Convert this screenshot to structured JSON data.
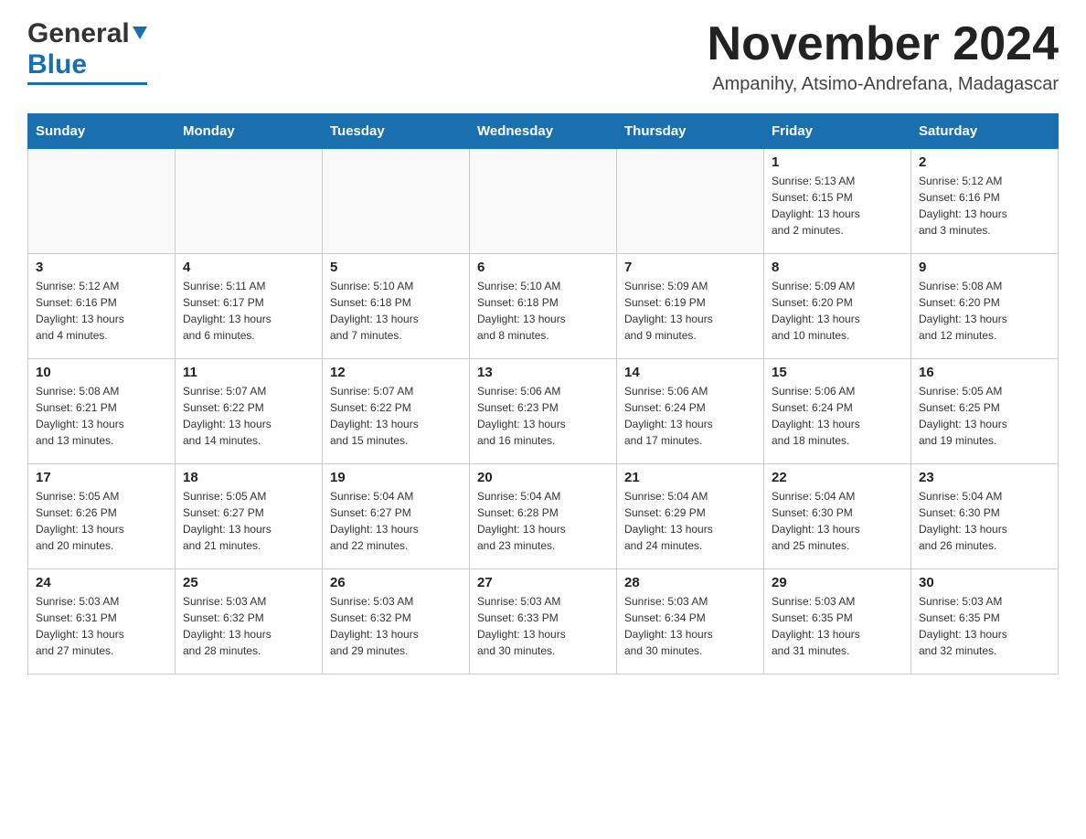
{
  "logo": {
    "general": "General",
    "blue": "Blue"
  },
  "header": {
    "month": "November 2024",
    "location": "Ampanihy, Atsimo-Andrefana, Madagascar"
  },
  "days_of_week": [
    "Sunday",
    "Monday",
    "Tuesday",
    "Wednesday",
    "Thursday",
    "Friday",
    "Saturday"
  ],
  "weeks": [
    [
      {
        "day": "",
        "info": ""
      },
      {
        "day": "",
        "info": ""
      },
      {
        "day": "",
        "info": ""
      },
      {
        "day": "",
        "info": ""
      },
      {
        "day": "",
        "info": ""
      },
      {
        "day": "1",
        "info": "Sunrise: 5:13 AM\nSunset: 6:15 PM\nDaylight: 13 hours\nand 2 minutes."
      },
      {
        "day": "2",
        "info": "Sunrise: 5:12 AM\nSunset: 6:16 PM\nDaylight: 13 hours\nand 3 minutes."
      }
    ],
    [
      {
        "day": "3",
        "info": "Sunrise: 5:12 AM\nSunset: 6:16 PM\nDaylight: 13 hours\nand 4 minutes."
      },
      {
        "day": "4",
        "info": "Sunrise: 5:11 AM\nSunset: 6:17 PM\nDaylight: 13 hours\nand 6 minutes."
      },
      {
        "day": "5",
        "info": "Sunrise: 5:10 AM\nSunset: 6:18 PM\nDaylight: 13 hours\nand 7 minutes."
      },
      {
        "day": "6",
        "info": "Sunrise: 5:10 AM\nSunset: 6:18 PM\nDaylight: 13 hours\nand 8 minutes."
      },
      {
        "day": "7",
        "info": "Sunrise: 5:09 AM\nSunset: 6:19 PM\nDaylight: 13 hours\nand 9 minutes."
      },
      {
        "day": "8",
        "info": "Sunrise: 5:09 AM\nSunset: 6:20 PM\nDaylight: 13 hours\nand 10 minutes."
      },
      {
        "day": "9",
        "info": "Sunrise: 5:08 AM\nSunset: 6:20 PM\nDaylight: 13 hours\nand 12 minutes."
      }
    ],
    [
      {
        "day": "10",
        "info": "Sunrise: 5:08 AM\nSunset: 6:21 PM\nDaylight: 13 hours\nand 13 minutes."
      },
      {
        "day": "11",
        "info": "Sunrise: 5:07 AM\nSunset: 6:22 PM\nDaylight: 13 hours\nand 14 minutes."
      },
      {
        "day": "12",
        "info": "Sunrise: 5:07 AM\nSunset: 6:22 PM\nDaylight: 13 hours\nand 15 minutes."
      },
      {
        "day": "13",
        "info": "Sunrise: 5:06 AM\nSunset: 6:23 PM\nDaylight: 13 hours\nand 16 minutes."
      },
      {
        "day": "14",
        "info": "Sunrise: 5:06 AM\nSunset: 6:24 PM\nDaylight: 13 hours\nand 17 minutes."
      },
      {
        "day": "15",
        "info": "Sunrise: 5:06 AM\nSunset: 6:24 PM\nDaylight: 13 hours\nand 18 minutes."
      },
      {
        "day": "16",
        "info": "Sunrise: 5:05 AM\nSunset: 6:25 PM\nDaylight: 13 hours\nand 19 minutes."
      }
    ],
    [
      {
        "day": "17",
        "info": "Sunrise: 5:05 AM\nSunset: 6:26 PM\nDaylight: 13 hours\nand 20 minutes."
      },
      {
        "day": "18",
        "info": "Sunrise: 5:05 AM\nSunset: 6:27 PM\nDaylight: 13 hours\nand 21 minutes."
      },
      {
        "day": "19",
        "info": "Sunrise: 5:04 AM\nSunset: 6:27 PM\nDaylight: 13 hours\nand 22 minutes."
      },
      {
        "day": "20",
        "info": "Sunrise: 5:04 AM\nSunset: 6:28 PM\nDaylight: 13 hours\nand 23 minutes."
      },
      {
        "day": "21",
        "info": "Sunrise: 5:04 AM\nSunset: 6:29 PM\nDaylight: 13 hours\nand 24 minutes."
      },
      {
        "day": "22",
        "info": "Sunrise: 5:04 AM\nSunset: 6:30 PM\nDaylight: 13 hours\nand 25 minutes."
      },
      {
        "day": "23",
        "info": "Sunrise: 5:04 AM\nSunset: 6:30 PM\nDaylight: 13 hours\nand 26 minutes."
      }
    ],
    [
      {
        "day": "24",
        "info": "Sunrise: 5:03 AM\nSunset: 6:31 PM\nDaylight: 13 hours\nand 27 minutes."
      },
      {
        "day": "25",
        "info": "Sunrise: 5:03 AM\nSunset: 6:32 PM\nDaylight: 13 hours\nand 28 minutes."
      },
      {
        "day": "26",
        "info": "Sunrise: 5:03 AM\nSunset: 6:32 PM\nDaylight: 13 hours\nand 29 minutes."
      },
      {
        "day": "27",
        "info": "Sunrise: 5:03 AM\nSunset: 6:33 PM\nDaylight: 13 hours\nand 30 minutes."
      },
      {
        "day": "28",
        "info": "Sunrise: 5:03 AM\nSunset: 6:34 PM\nDaylight: 13 hours\nand 30 minutes."
      },
      {
        "day": "29",
        "info": "Sunrise: 5:03 AM\nSunset: 6:35 PM\nDaylight: 13 hours\nand 31 minutes."
      },
      {
        "day": "30",
        "info": "Sunrise: 5:03 AM\nSunset: 6:35 PM\nDaylight: 13 hours\nand 32 minutes."
      }
    ]
  ]
}
